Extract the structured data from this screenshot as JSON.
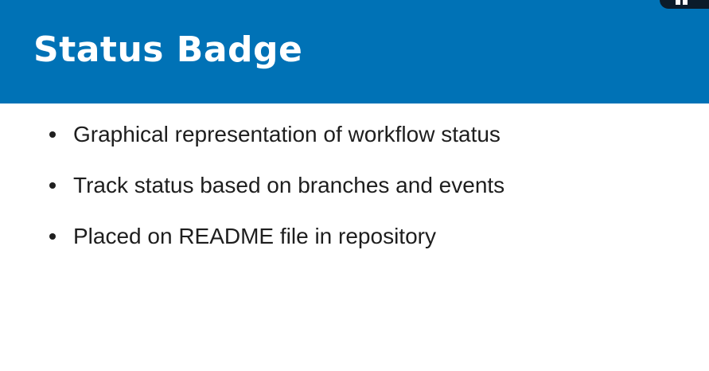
{
  "slide": {
    "title": "Status Badge",
    "bullets": [
      "Graphical representation of workflow status",
      "Track status based on branches and events",
      "Placed on README file in repository"
    ]
  },
  "colors": {
    "header_background": "#0072b6",
    "title_text": "#ffffff",
    "body_text": "#1e1e1e",
    "background": "#ffffff"
  },
  "icons": {
    "corner_widget": "grid-icon"
  }
}
